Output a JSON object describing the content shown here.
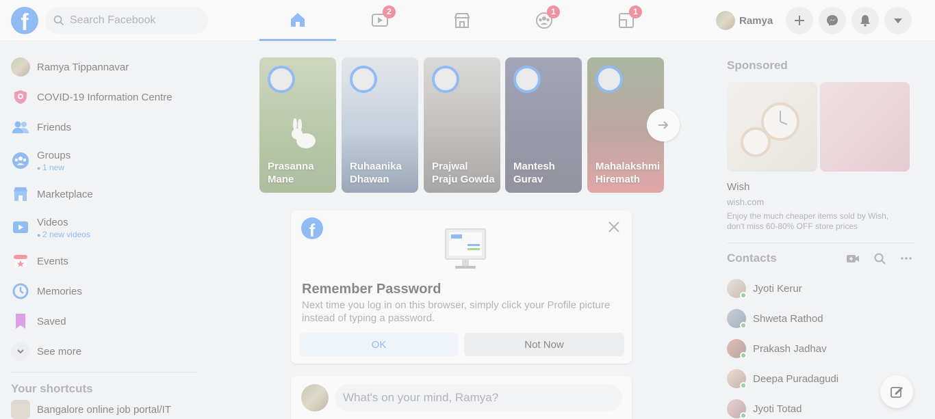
{
  "header": {
    "logo": "f",
    "search_placeholder": "Search Facebook",
    "badges": {
      "watch": "2",
      "groups": "1",
      "gaming": "1"
    },
    "profile_name": "Ramya"
  },
  "left_nav": {
    "items": [
      {
        "label": "Ramya Tippannavar"
      },
      {
        "label": "COVID-19 Information Centre"
      },
      {
        "label": "Friends"
      },
      {
        "label": "Groups",
        "sub": "1 new"
      },
      {
        "label": "Marketplace"
      },
      {
        "label": "Videos",
        "sub": "2 new videos"
      },
      {
        "label": "Events"
      },
      {
        "label": "Memories"
      },
      {
        "label": "Saved"
      },
      {
        "label": "See more"
      }
    ],
    "shortcuts_heading": "Your shortcuts",
    "shortcut_first": "Bangalore online job portal/IT"
  },
  "stories": [
    {
      "name": "Prasanna Mane"
    },
    {
      "name": "Ruhaanika Dhawan"
    },
    {
      "name": "Prajwal Praju Gowda"
    },
    {
      "name": "Mantesh Gurav"
    },
    {
      "name": "Mahalakshmi Hiremath"
    }
  ],
  "dialog": {
    "title": "Remember Password",
    "body": "Next time you log in on this browser, simply click your Profile picture instead of typing a password.",
    "ok_label": "OK",
    "not_now_label": "Not Now"
  },
  "composer": {
    "placeholder": "What's on your mind, Ramya?"
  },
  "sponsored": {
    "heading": "Sponsored",
    "title": "Wish",
    "domain": "wish.com",
    "text": "Enjoy the much cheaper items sold by Wish, don't miss 60-80% OFF store prices"
  },
  "contacts": {
    "heading": "Contacts",
    "items": [
      "Jyoti Kerur",
      "Shweta Rathod",
      "Prakash Jadhav",
      "Deepa Puradagudi",
      "Jyoti Totad"
    ]
  },
  "colors": {
    "brand": "#1877f2",
    "badge": "#e41e3f",
    "online": "#31a24c"
  }
}
